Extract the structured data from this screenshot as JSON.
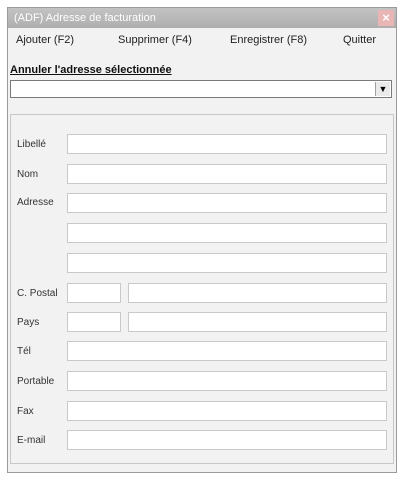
{
  "window": {
    "title": "(ADF) Adresse de facturation",
    "close_glyph": "×"
  },
  "menu": {
    "items": [
      "Ajouter (F2)",
      "Supprimer (F4)",
      "Enregistrer (F8)",
      "Quitter"
    ]
  },
  "cancel_link": "Annuler l'adresse sélectionnée",
  "combo": {
    "value": "",
    "arrow": "▼"
  },
  "form": {
    "labels": {
      "libelle": "Libellé",
      "nom": "Nom",
      "adresse": "Adresse",
      "cpostal": "C. Postal",
      "pays": "Pays",
      "tel": "Tél",
      "portable": "Portable",
      "fax": "Fax",
      "email": "E-mail"
    },
    "values": {
      "libelle": "",
      "nom": "",
      "adresse1": "",
      "adresse2": "",
      "adresse3": "",
      "cpostal_code": "",
      "cpostal_ville": "",
      "pays_code": "",
      "pays_nom": "",
      "tel": "",
      "portable": "",
      "fax": "",
      "email": ""
    }
  }
}
